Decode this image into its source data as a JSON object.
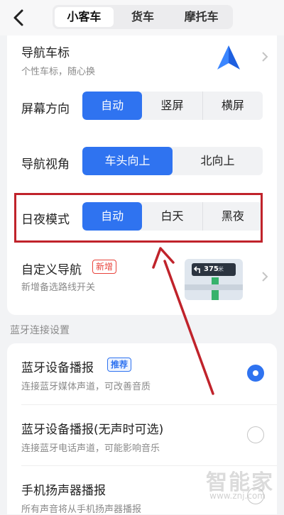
{
  "tabs": [
    "小客车",
    "货车",
    "摩托车"
  ],
  "nav_icon": {
    "title": "导航车标",
    "subtitle": "个性车标，随心换",
    "icon": "navigation-arrow-icon",
    "color": "#2f73f0"
  },
  "screen_orientation": {
    "title": "屏幕方向",
    "options": [
      "自动",
      "竖屏",
      "横屏"
    ],
    "selected": "自动"
  },
  "nav_view": {
    "title": "导航视角",
    "options": [
      "车头向上",
      "北向上"
    ],
    "selected": "车头向上"
  },
  "day_night": {
    "title": "日夜模式",
    "options": [
      "自动",
      "白天",
      "黑夜"
    ],
    "selected": "自动"
  },
  "custom_nav": {
    "title": "自定义导航",
    "badge": "新增",
    "subtitle": "新增备选路线开关",
    "preview_text": "375",
    "preview_unit": "米"
  },
  "section_bluetooth": "蓝牙连接设置",
  "bt_media": {
    "title": "蓝牙设备播报",
    "badge": "推荐",
    "subtitle": "连接蓝牙媒体声道，可改善音质",
    "selected": true
  },
  "bt_phone": {
    "title": "蓝牙设备播报(无声时可选)",
    "subtitle": "连接蓝牙电话声道，可能影响音乐",
    "selected": false
  },
  "speaker": {
    "title": "手机扬声器播报",
    "subtitle": "所有声音将从手机扬声器播报"
  },
  "watermark": {
    "text": "智能家",
    "url": "www.znj.com"
  },
  "colors": {
    "accent": "#2f73f0",
    "highlight": "#c0232b",
    "new_badge": "#e8433b"
  }
}
